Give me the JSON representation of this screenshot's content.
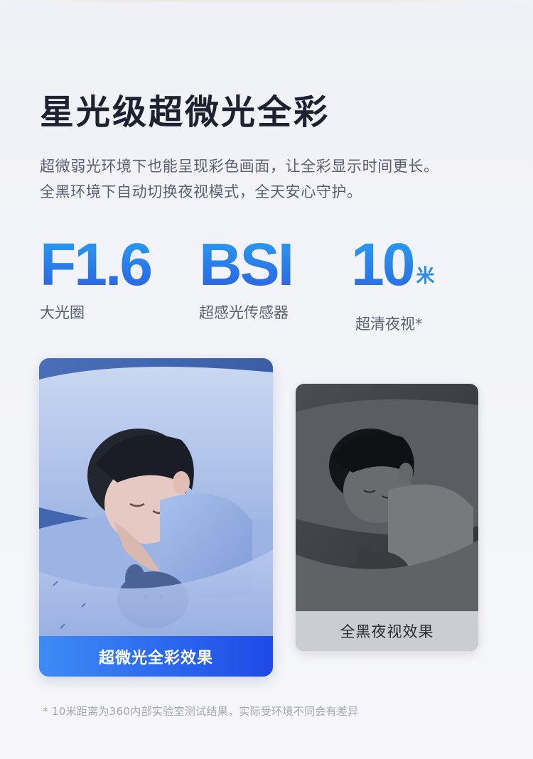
{
  "header": {
    "title": "星光级超微光全彩",
    "description_line1": "超微弱光环境下也能呈现彩色画面，让全彩显示时间更长。",
    "description_line2": "全黑环境下自动切换夜视模式，全天安心守护。"
  },
  "specs": [
    {
      "value": "F1.6",
      "unit": "",
      "label": "大光圈"
    },
    {
      "value": "BSI",
      "unit": "",
      "label": "超感光传感器"
    },
    {
      "value": "10",
      "unit": "米",
      "label": "超清夜视*"
    }
  ],
  "comparison": {
    "color_caption": "超微光全彩效果",
    "night_caption": "全黑夜视效果"
  },
  "footnote": "* 10米距离为360内部实验室测试结果，实际受环境不同会有差异",
  "colors": {
    "title": "#1e2230",
    "accent_blue": "#2a7ce8",
    "text_gray": "#5b6070",
    "footnote_gray": "#a4a7b0"
  }
}
